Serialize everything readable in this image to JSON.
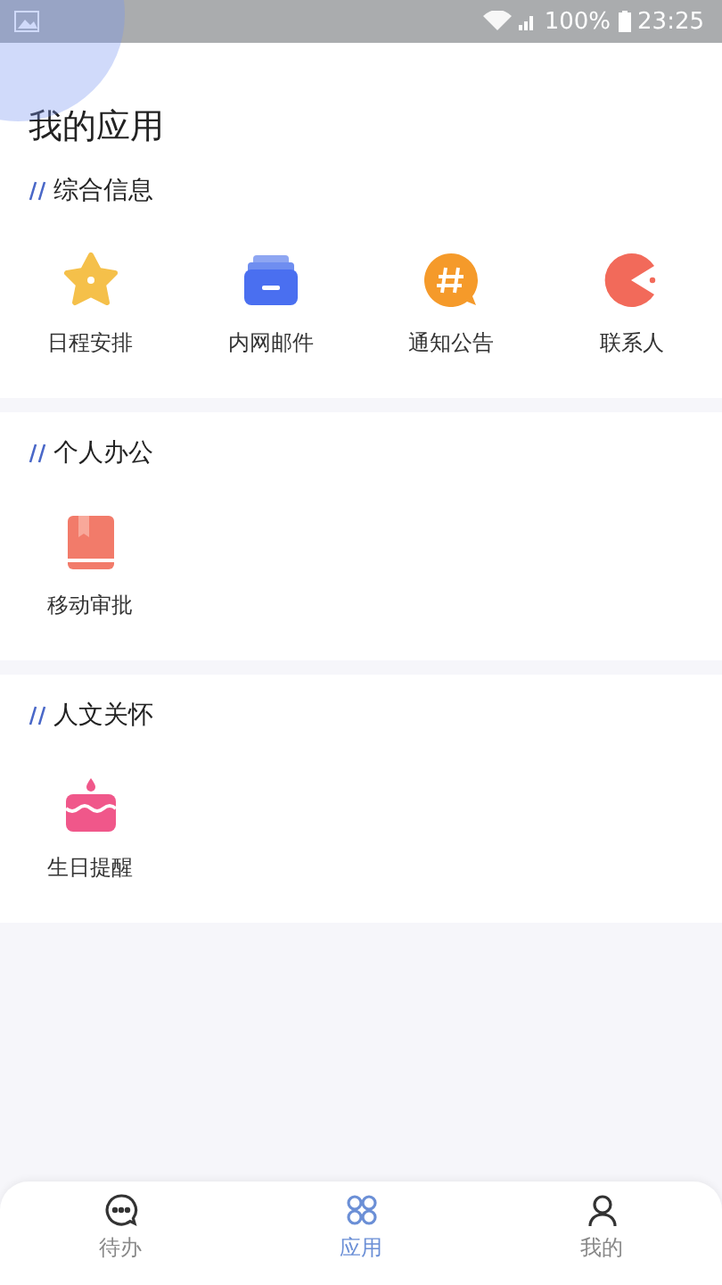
{
  "status_bar": {
    "battery": "100%",
    "time": "23:25"
  },
  "page_title": "我的应用",
  "sections": [
    {
      "title": "综合信息",
      "apps": [
        {
          "label": "日程安排",
          "kind": "star"
        },
        {
          "label": "内网邮件",
          "kind": "tray"
        },
        {
          "label": "通知公告",
          "kind": "hash"
        },
        {
          "label": "联系人",
          "kind": "pacman"
        }
      ]
    },
    {
      "title": "个人办公",
      "apps": [
        {
          "label": "移动审批",
          "kind": "book"
        }
      ]
    },
    {
      "title": "人文关怀",
      "apps": [
        {
          "label": "生日提醒",
          "kind": "cake"
        }
      ]
    }
  ],
  "tabs": [
    {
      "label": "待办",
      "kind": "chat",
      "selected": false
    },
    {
      "label": "应用",
      "kind": "grid",
      "selected": true
    },
    {
      "label": "我的",
      "kind": "user",
      "selected": false
    }
  ]
}
